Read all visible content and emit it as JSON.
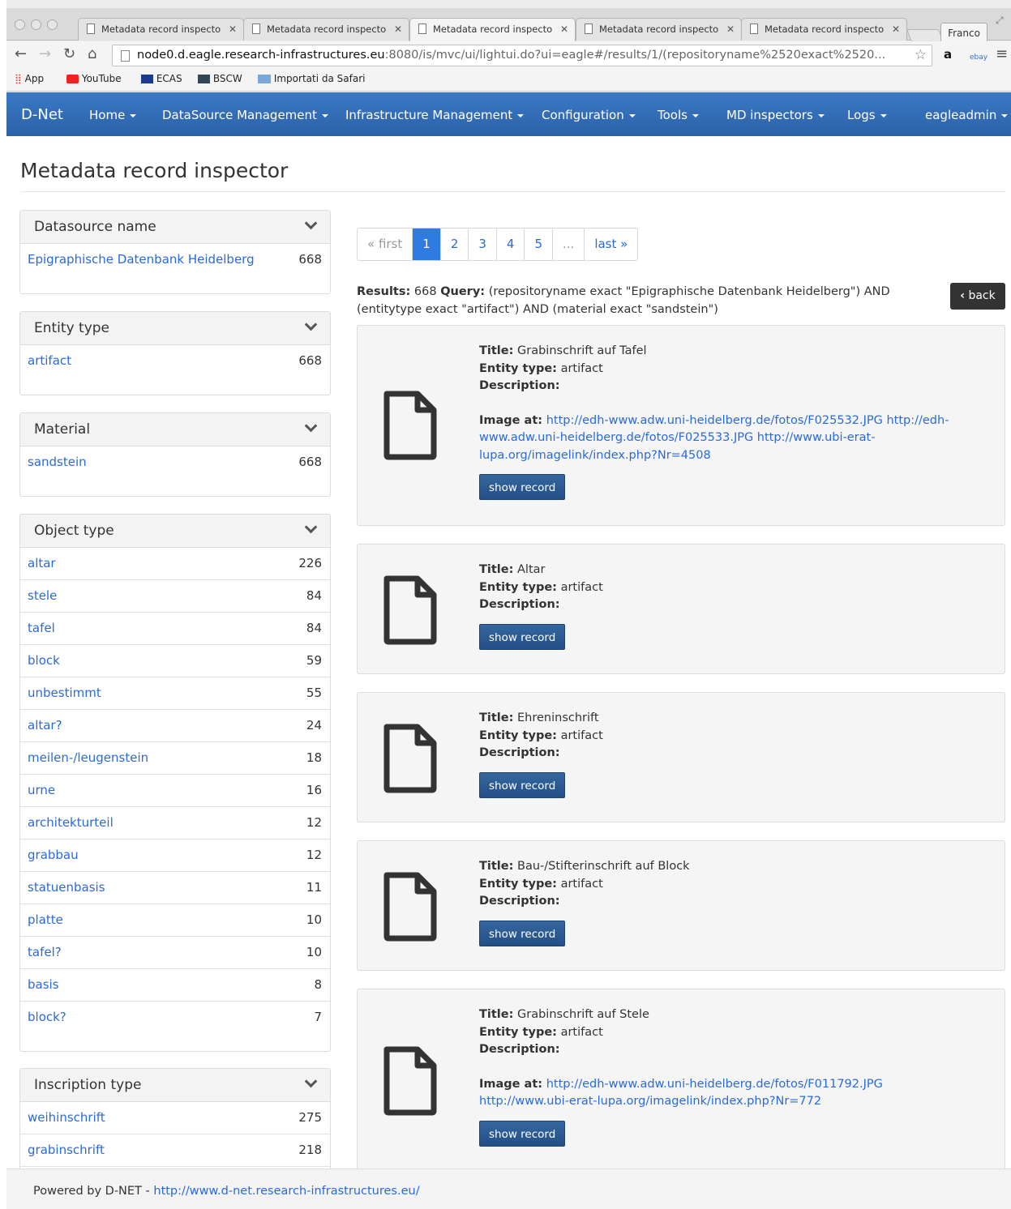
{
  "browser": {
    "tabs": [
      {
        "label": "Metadata record inspecto"
      },
      {
        "label": "Metadata record inspecto"
      },
      {
        "label": "Metadata record inspecto"
      },
      {
        "label": "Metadata record inspecto"
      },
      {
        "label": "Metadata record inspecto"
      }
    ],
    "profile": "Franco",
    "url_host": "node0.d.eagle.research-infrastructures.eu",
    "url_rest": ":8080/is/mvc/ui/lightui.do?ui=eagle#/results/1/(repositoryname%2520exact%2520...",
    "bookmarks": [
      "App",
      "YouTube",
      "ECAS",
      "BSCW",
      "Importati da Safari"
    ]
  },
  "navbar": {
    "brand": "D-Net",
    "items": [
      "Home",
      "DataSource Management",
      "Infrastructure Management",
      "Configuration",
      "Tools",
      "MD inspectors",
      "Logs",
      "eagleadmin"
    ]
  },
  "page": {
    "title": "Metadata record inspector"
  },
  "facets": [
    {
      "title": "Datasource name",
      "rows": [
        {
          "label": "Epigraphische Datenbank Heidelberg",
          "count": "668"
        }
      ]
    },
    {
      "title": "Entity type",
      "rows": [
        {
          "label": "artifact",
          "count": "668"
        }
      ]
    },
    {
      "title": "Material",
      "rows": [
        {
          "label": "sandstein",
          "count": "668"
        }
      ]
    },
    {
      "title": "Object type",
      "rows": [
        {
          "label": "altar",
          "count": "226"
        },
        {
          "label": "stele",
          "count": "84"
        },
        {
          "label": "tafel",
          "count": "84"
        },
        {
          "label": "block",
          "count": "59"
        },
        {
          "label": "unbestimmt",
          "count": "55"
        },
        {
          "label": "altar?",
          "count": "24"
        },
        {
          "label": "meilen-/leugenstein",
          "count": "18"
        },
        {
          "label": "urne",
          "count": "16"
        },
        {
          "label": "architekturteil",
          "count": "12"
        },
        {
          "label": "grabbau",
          "count": "12"
        },
        {
          "label": "statuenbasis",
          "count": "11"
        },
        {
          "label": "platte",
          "count": "10"
        },
        {
          "label": "tafel?",
          "count": "10"
        },
        {
          "label": "basis",
          "count": "8"
        },
        {
          "label": "block?",
          "count": "7"
        }
      ]
    },
    {
      "title": "Inscription type",
      "rows": [
        {
          "label": "weihinschrift",
          "count": "275"
        },
        {
          "label": "grabinschrift",
          "count": "218"
        }
      ]
    }
  ],
  "pagination": [
    "« first",
    "1",
    "2",
    "3",
    "4",
    "5",
    "...",
    "last »"
  ],
  "results_header": {
    "results_label": "Results:",
    "results_count": "668",
    "query_label": "Query:",
    "query": "(repositoryname exact \"Epigraphische Datenbank Heidelberg\") AND (entitytype exact \"artifact\") AND (material exact \"sandstein\")",
    "back_label": "back"
  },
  "labels": {
    "title": "Title:",
    "entity_type": "Entity type:",
    "description": "Description:",
    "image_at": "Image at:",
    "show_record": "show record"
  },
  "results": [
    {
      "title": "Grabinschrift auf Tafel",
      "entity_type": "artifact",
      "image_at": "http://edh-www.adw.uni-heidelberg.de/fotos/F025532.JPG http://edh-www.adw.uni-heidelberg.de/fotos/F025533.JPG http://www.ubi-erat-lupa.org/imagelink/index.php?Nr=4508"
    },
    {
      "title": "Altar",
      "entity_type": "artifact",
      "image_at": ""
    },
    {
      "title": "Ehreninschrift",
      "entity_type": "artifact",
      "image_at": ""
    },
    {
      "title": "Bau-/Stifterinschrift auf Block",
      "entity_type": "artifact",
      "image_at": ""
    },
    {
      "title": "Grabinschrift auf Stele",
      "entity_type": "artifact",
      "image_at": "http://edh-www.adw.uni-heidelberg.de/fotos/F011792.JPG http://www.ubi-erat-lupa.org/imagelink/index.php?Nr=772"
    }
  ],
  "footer": {
    "text": "Powered by D-NET - ",
    "link": "http://www.d-net.research-infrastructures.eu/"
  }
}
